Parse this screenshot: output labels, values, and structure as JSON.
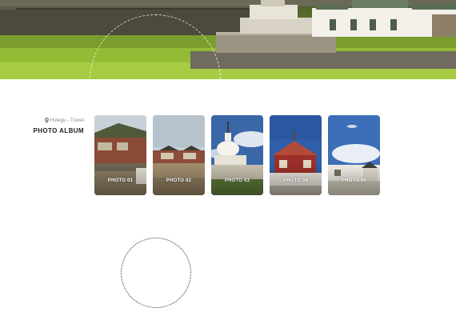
{
  "album": {
    "location": "Hulegu - Travel",
    "title": "PHOTO ALBUM"
  },
  "photos": [
    {
      "label": "PHOTO 01"
    },
    {
      "label": "PHOTO 02"
    },
    {
      "label": "PHOTO 03"
    },
    {
      "label": "PHOTO 04"
    },
    {
      "label": "PHOTO 05"
    }
  ],
  "colors": {
    "background": "#ffffff",
    "heading": "#222222",
    "meta": "#888888",
    "caption": "#ffffff",
    "ring": "#333333"
  },
  "icons": {
    "location": "map-pin-icon"
  }
}
